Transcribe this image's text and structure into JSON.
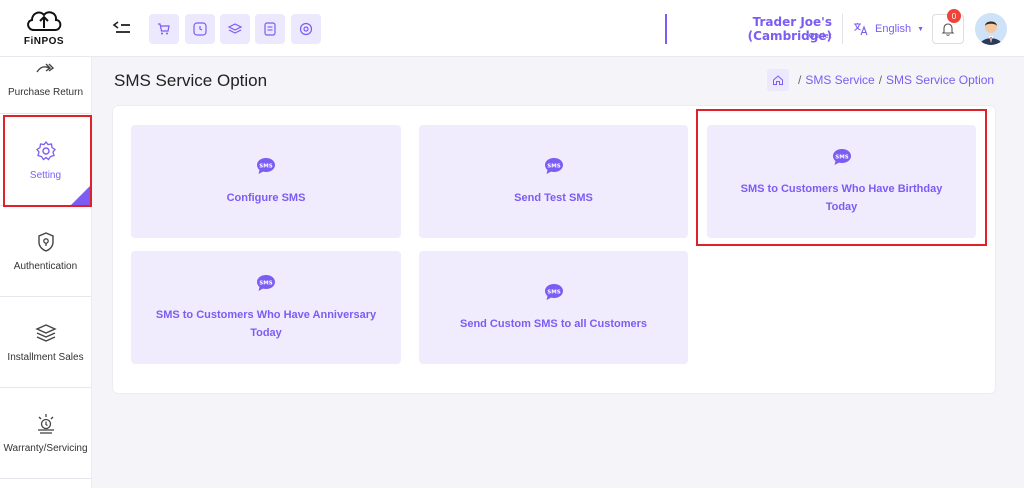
{
  "brand": {
    "logo_text": "FiNPOS"
  },
  "quick_actions": [
    "cart-icon",
    "clock-icon",
    "stack-icon",
    "document-icon",
    "target-icon"
  ],
  "store": {
    "name": "Trader Joe's (Cambridge)",
    "sub": "Outlet"
  },
  "language": {
    "label": "English"
  },
  "notifications": {
    "count": "0"
  },
  "sidebar": {
    "items": [
      {
        "label": "Purchase Return",
        "icon": "return-arrow-icon"
      },
      {
        "label": "Setting",
        "icon": "gear-icon"
      },
      {
        "label": "Authentication",
        "icon": "shield-icon"
      },
      {
        "label": "Installment Sales",
        "icon": "layers-icon"
      },
      {
        "label": "Warranty/Servicing",
        "icon": "servicing-icon"
      }
    ]
  },
  "page": {
    "title": "SMS Service Option",
    "breadcrumb": [
      "SMS Service",
      "SMS Service Option"
    ]
  },
  "cards": [
    {
      "label": "Configure SMS"
    },
    {
      "label": "Send Test SMS"
    },
    {
      "label": "SMS to Customers Who Have Birthday Today"
    },
    {
      "label": "SMS to Customers Who Have Anniversary Today"
    },
    {
      "label": "Send Custom SMS to all Customers"
    }
  ],
  "icon_text": "SMS",
  "colors": {
    "accent": "#7c5cf3",
    "card_bg": "#f0ecfd",
    "highlight": "#e0202a",
    "badge": "#f04438"
  }
}
